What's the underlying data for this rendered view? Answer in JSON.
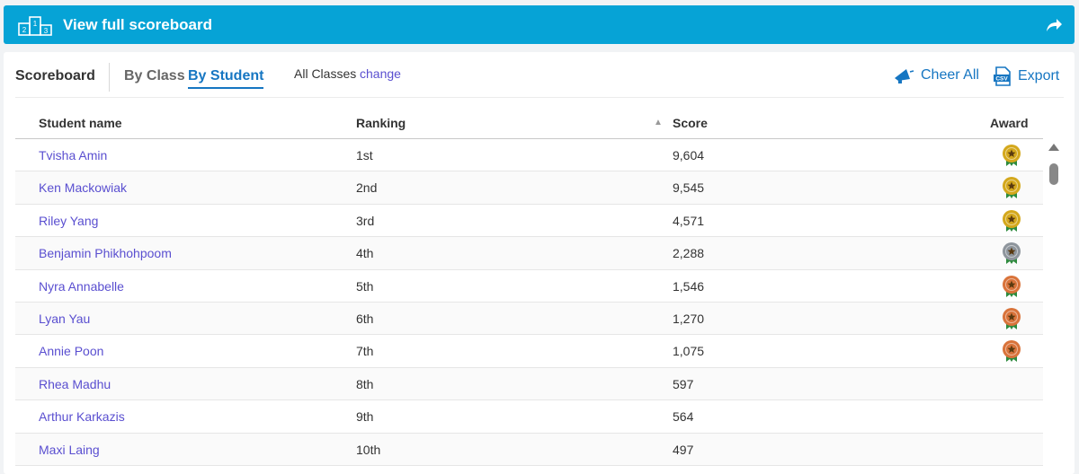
{
  "banner": {
    "title": "View full scoreboard",
    "podium_numbers": [
      "2",
      "1",
      "3"
    ],
    "icon": "podium-icon",
    "action_icon": "share-arrow-icon"
  },
  "toolbar": {
    "scoreboard_label": "Scoreboard",
    "by_class_label": "By Class",
    "by_student_label": "By Student",
    "filter_label": "All Classes",
    "filter_change": "change",
    "cheer_label": "Cheer All",
    "export_label": "Export",
    "cheer_icon": "megaphone-icon",
    "export_icon": "csv-icon"
  },
  "table": {
    "headers": {
      "name": "Student name",
      "ranking": "Ranking",
      "sort_indicator": "▲",
      "score": "Score",
      "award": "Award"
    },
    "rows": [
      {
        "name": "Tvisha Amin",
        "ranking": "1st",
        "score": "9,604",
        "award": "gold"
      },
      {
        "name": "Ken Mackowiak",
        "ranking": "2nd",
        "score": "9,545",
        "award": "gold"
      },
      {
        "name": "Riley Yang",
        "ranking": "3rd",
        "score": "4,571",
        "award": "gold"
      },
      {
        "name": "Benjamin Phikhohpoom",
        "ranking": "4th",
        "score": "2,288",
        "award": "silver"
      },
      {
        "name": "Nyra Annabelle",
        "ranking": "5th",
        "score": "1,546",
        "award": "bronze"
      },
      {
        "name": "Lyan Yau",
        "ranking": "6th",
        "score": "1,270",
        "award": "bronze"
      },
      {
        "name": "Annie Poon",
        "ranking": "7th",
        "score": "1,075",
        "award": "bronze"
      },
      {
        "name": "Rhea Madhu",
        "ranking": "8th",
        "score": "597",
        "award": ""
      },
      {
        "name": "Arthur Karkazis",
        "ranking": "9th",
        "score": "564",
        "award": ""
      },
      {
        "name": "Maxi Laing",
        "ranking": "10th",
        "score": "497",
        "award": ""
      }
    ]
  },
  "colors": {
    "banner": "#06a3d6",
    "link": "#5a4fd0",
    "accent": "#1676c2",
    "gold": "#d4a81c",
    "silver": "#8e959c",
    "bronze": "#d9733a",
    "ribbon": "#2e8b3e"
  }
}
